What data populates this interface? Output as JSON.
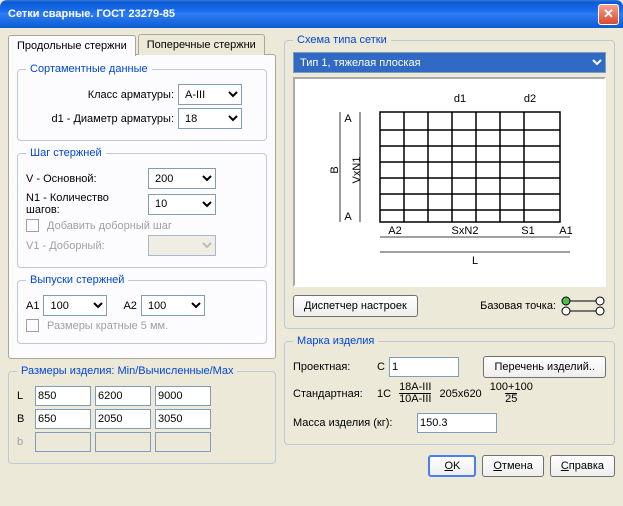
{
  "title": "Сетки сварные. ГОСТ 23279-85",
  "tabs": {
    "long": "Продольные стержни",
    "cross": "Поперечные стержни"
  },
  "assort": {
    "legend": "Сортаментные данные",
    "class_lbl": "Класс арматуры:",
    "class_val": "A-III",
    "d1_lbl": "d1 - Диаметр арматуры:",
    "d1_val": "18"
  },
  "step": {
    "legend": "Шаг стержней",
    "v_lbl": "V   - Основной:",
    "v_val": "200",
    "n1_lbl": "N1 - Количество шагов:",
    "n1_val": "10",
    "add_lbl": "Добавить доборный шаг",
    "v1_lbl": "V1 - Доборный:",
    "v1_val": ""
  },
  "release": {
    "legend": "Выпуски стержней",
    "a1_lbl": "A1",
    "a1_val": "100",
    "a2_lbl": "A2",
    "a2_val": "100",
    "round_lbl": "Размеры кратные 5 мм."
  },
  "sizes": {
    "legend": "Размеры изделия: Min/Вычисленные/Max",
    "L_lbl": "L",
    "L_min": "850",
    "L_calc": "6200",
    "L_max": "9000",
    "B_lbl": "B",
    "B_min": "650",
    "B_calc": "2050",
    "B_max": "3050",
    "b_lbl": "b",
    "b_min": "",
    "b_calc": "",
    "b_max": ""
  },
  "schema": {
    "legend": "Схема типа сетки",
    "type": "Тип 1, тяжелая плоская",
    "labels": {
      "d1": "d1",
      "d2": "d2",
      "A": "A",
      "B": "B",
      "VxN1": "VxN1",
      "A2": "A2",
      "SxN2": "SxN2",
      "S1": "S1",
      "A1": "A1",
      "L": "L"
    },
    "dispatcher": "Диспетчер настроек",
    "basepoint_lbl": "Базовая точка:"
  },
  "mark": {
    "legend": "Марка изделия",
    "proj_lbl": "Проектная:",
    "proj_prefix": "С",
    "proj_val": "1",
    "list_btn": "Перечень изделий..",
    "std_lbl": "Стандартная:",
    "std_prefix": "1С",
    "frac1_top": "18A-III",
    "frac1_bot": "10A-III",
    "middle": "205x620",
    "frac2_top": "100+100",
    "frac2_bot": "25",
    "mass_lbl": "Масса изделия (кг):",
    "mass_val": "150.3"
  },
  "buttons": {
    "ok": "OK",
    "cancel": "Отмена",
    "help": "Справка"
  }
}
